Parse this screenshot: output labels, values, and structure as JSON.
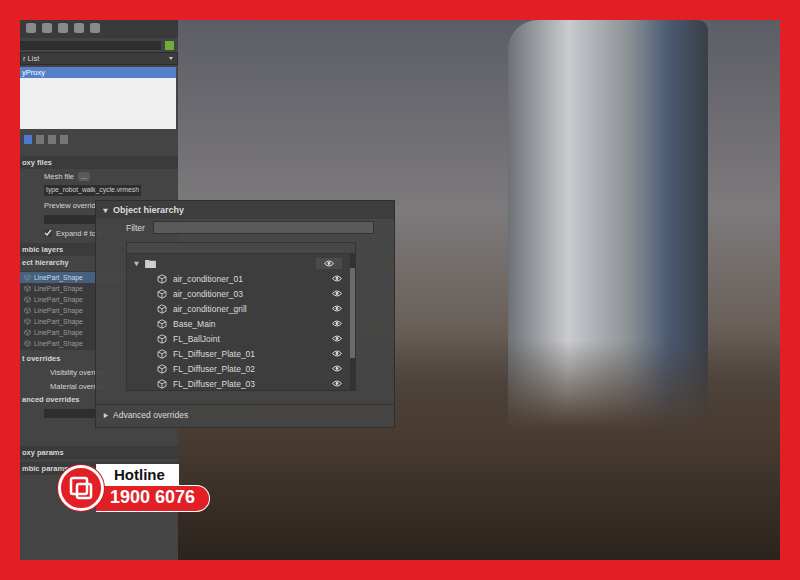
{
  "left_panel": {
    "list_dropdown": "r List",
    "list_items": [
      {
        "label": "yProxy",
        "selected": true
      }
    ],
    "proxy_files": {
      "header": "oxy files",
      "mesh_label": "Mesh file",
      "browse": "...",
      "mesh_value": "type_robot_walk_cycle.vrmesh",
      "preview_label": "Preview override",
      "expand_label": "Expand # to fr",
      "expand_checked": true
    },
    "alembic_header": "mbic layers",
    "hierarchy_label": "ect hierarchy",
    "tree_rows": [
      {
        "label": "LinePart_Shape",
        "selected": true
      },
      {
        "label": "LinePart_Shape",
        "selected": false
      },
      {
        "label": "LinePart_Shape",
        "selected": false
      },
      {
        "label": "LinePart_Shape",
        "selected": false
      },
      {
        "label": "LinePart_Shape",
        "selected": false
      },
      {
        "label": "LinePart_Shape",
        "selected": false
      },
      {
        "label": "LinePart_Shape",
        "selected": false
      }
    ],
    "overrides_header": "t overrides",
    "visibility_label": "Visibility override",
    "material_label": "Material override",
    "advanced_header": "anced overrides",
    "proxy_params": "oxy params",
    "alembic_params": "mbic params"
  },
  "hierarchy_panel": {
    "title": "Object hierarchy",
    "expanded": true,
    "filter_label": "Filter",
    "filter_value": "",
    "root_expanded": true,
    "items": [
      {
        "name": "air_conditioner_01",
        "visible": true
      },
      {
        "name": "air_conditioner_03",
        "visible": true
      },
      {
        "name": "air_conditioner_grill",
        "visible": true
      },
      {
        "name": "Base_Main",
        "visible": true
      },
      {
        "name": "FL_BallJoint",
        "visible": true
      },
      {
        "name": "FL_Diffuser_Plate_01",
        "visible": true
      },
      {
        "name": "FL_Diffuser_Plate_02",
        "visible": true
      },
      {
        "name": "FL_Diffuser_Plate_03",
        "visible": true
      }
    ],
    "advanced": {
      "label": "Advanced overrides",
      "expanded": false
    }
  },
  "hotline": {
    "label": "Hotline",
    "number": "1900 6076"
  }
}
